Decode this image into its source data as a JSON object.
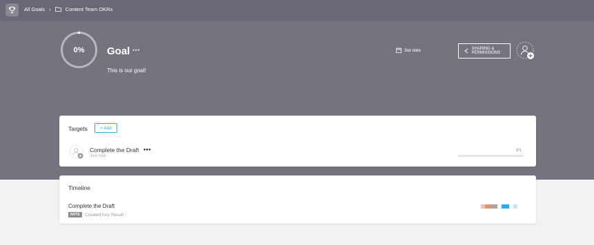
{
  "topbar": {
    "crumb_root": "All Goals",
    "crumb_folder": "Content Team OKRs"
  },
  "goal": {
    "progress_percent": 0,
    "progress_label": "0%",
    "title": "Goal",
    "more_label": "•••",
    "description": "This is our goal!",
    "set_date_label": "Set date",
    "sharing_label": "SHARING & PERMISSIONS"
  },
  "targets": {
    "title": "Targets",
    "add_label": "+ Add",
    "items": [
      {
        "title": "Complete the Draft",
        "more_label": "•••",
        "time": "Just now",
        "count": "0/1",
        "progress": 0
      }
    ]
  },
  "timeline": {
    "title": "Timeline",
    "items": [
      {
        "title": "Complete the Draft",
        "badge": "NOTE",
        "subtitle": "Created Key Result"
      }
    ]
  },
  "colors": {
    "topbar": "#6b6876",
    "hero": "#76737f",
    "accent": "#29a8e0",
    "page_bg": "#f2f2f5"
  },
  "icons": {
    "trophy": "trophy-icon",
    "folder": "folder-icon",
    "calendar": "calendar-icon",
    "share": "share-icon",
    "add_user": "add-user-icon"
  }
}
